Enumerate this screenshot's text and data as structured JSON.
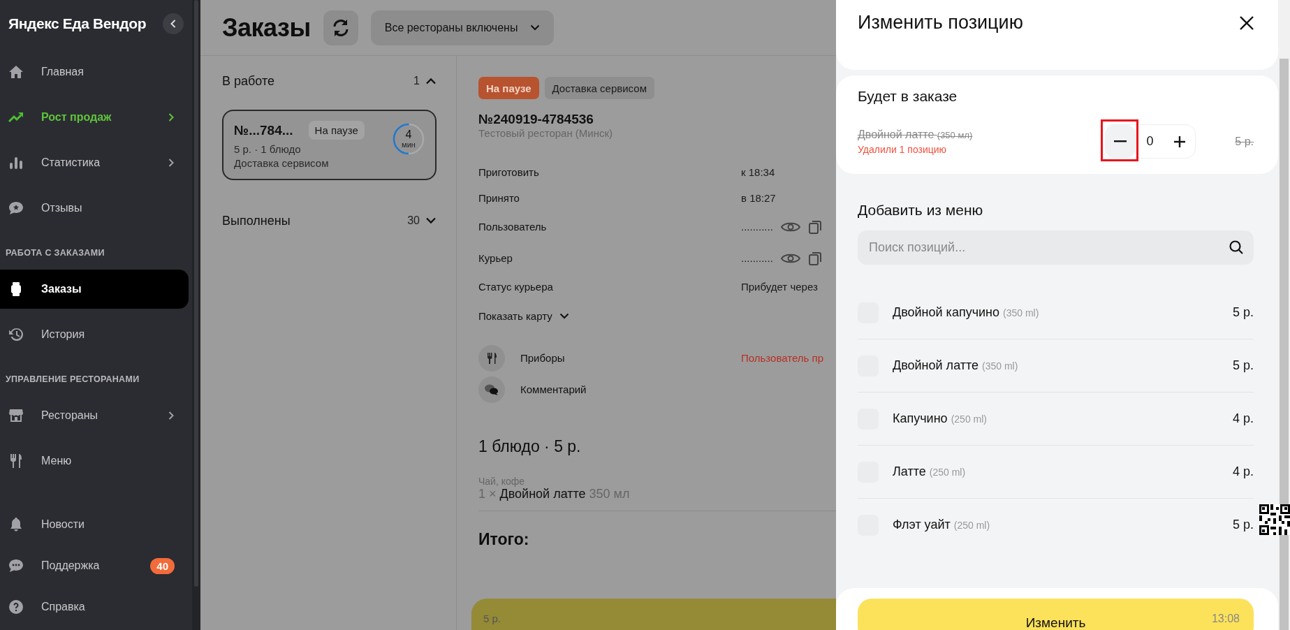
{
  "sidebar": {
    "logo": "Яндекс Еда Вендор",
    "sections": [
      {
        "items": [
          {
            "label": "Главная",
            "kind": "normal",
            "selected": false,
            "has_submenu": false
          },
          {
            "label": "Рост продаж",
            "kind": "promo",
            "selected": false,
            "has_submenu": true
          },
          {
            "label": "Статистика",
            "kind": "normal",
            "selected": false,
            "has_submenu": true
          },
          {
            "label": "Отзывы",
            "kind": "normal",
            "selected": false,
            "has_submenu": false
          }
        ]
      },
      {
        "heading": "РАБОТА С ЗАКАЗАМИ",
        "items": [
          {
            "label": "Заказы",
            "kind": "normal",
            "selected": true,
            "has_submenu": false
          },
          {
            "label": "История",
            "kind": "normal",
            "selected": false,
            "has_submenu": false
          }
        ]
      },
      {
        "heading": "УПРАВЛЕНИЕ РЕСТОРАНАМИ",
        "items": [
          {
            "label": "Рестораны",
            "kind": "normal",
            "selected": false,
            "has_submenu": true
          },
          {
            "label": "Меню",
            "kind": "normal",
            "selected": false,
            "has_submenu": false
          }
        ]
      },
      {
        "items": [
          {
            "label": "Новости",
            "kind": "normal",
            "selected": false,
            "has_submenu": false
          },
          {
            "label": "Поддержка",
            "kind": "normal",
            "selected": false,
            "has_submenu": false,
            "badge": "40"
          },
          {
            "label": "Справка",
            "kind": "normal",
            "selected": false,
            "has_submenu": false
          }
        ]
      }
    ]
  },
  "header": {
    "title": "Заказы",
    "restaurant_filter": "Все рестораны включены"
  },
  "order_groups": [
    {
      "title": "В работе",
      "count": "1",
      "expanded": true,
      "orders": [
        {
          "number": "№...784...",
          "status": "На паузе",
          "summary": "5 р. · 1 блюдо",
          "delivery": "Доставка сервисом",
          "timer": "4",
          "timer_unit": "мин",
          "level": 0.5,
          "selected": true
        }
      ]
    },
    {
      "title": "Выполнены",
      "count": "30",
      "expanded": false
    }
  ],
  "order_detail": {
    "tags": [
      {
        "label": "На паузе",
        "kind": "status"
      },
      {
        "label": "Доставка сервисом",
        "kind": "plain"
      }
    ],
    "number": "№240919-4784536",
    "restaurant": "Тестовый ресторан (Минск)",
    "fields": [
      {
        "label": "Приготовить",
        "value": "к 18:34",
        "kind": "text"
      },
      {
        "label": "Принято",
        "value": "в 18:27",
        "kind": "text"
      },
      {
        "label": "Пользователь",
        "value": "...........",
        "kind": "hidden"
      },
      {
        "label": "Курьер",
        "value": "...........",
        "kind": "hidden"
      },
      {
        "label": "Статус курьера",
        "value": "Прибудет через",
        "kind": "text"
      }
    ],
    "show_map": "Показать карту",
    "extras": [
      {
        "label": "Приборы",
        "value": "Пользователь пр",
        "kind": "cutlery"
      },
      {
        "label": "Комментарий",
        "kind": "comment"
      }
    ],
    "items_summary": "1 блюдо · 5 р.",
    "category": "Чай, кофе",
    "line": {
      "quantity": "1 ×",
      "name": "Двойной латте",
      "size": "350 мл"
    },
    "total_label": "Итого:",
    "bottom_price": "5 р."
  },
  "drawer": {
    "title": "Изменить позицию",
    "in_order": {
      "title": "Будет в заказе",
      "items": [
        {
          "name": "Двойной латте",
          "size": "(350 мл)",
          "note": "Удалили 1 позицию",
          "quantity": "0",
          "price": "5 р.",
          "removed": true
        }
      ]
    },
    "add_from_menu": {
      "title": "Добавить из меню",
      "search_placeholder": "Поиск позиций...",
      "items": [
        {
          "name": "Двойной капучино",
          "size": "(350 ml)",
          "price": "5 р.",
          "checked": false
        },
        {
          "name": "Двойной латте",
          "size": "(350 ml)",
          "price": "5 р.",
          "checked": false
        },
        {
          "name": "Капучино",
          "size": "(250 ml)",
          "price": "4 р.",
          "checked": false
        },
        {
          "name": "Латте",
          "size": "(250 ml)",
          "price": "4 р.",
          "checked": false
        },
        {
          "name": "Флэт уайт",
          "size": "(250 ml)",
          "price": "5 р.",
          "checked": false
        }
      ]
    },
    "submit": {
      "label": "Изменить",
      "time": "13:08"
    }
  }
}
